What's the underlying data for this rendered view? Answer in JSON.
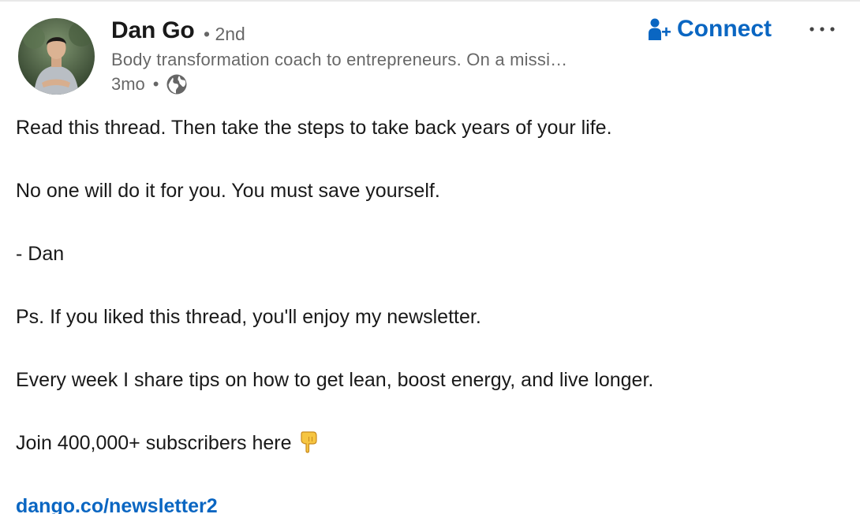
{
  "post": {
    "author": {
      "name": "Dan Go",
      "degree": "2nd",
      "headline": "Body transformation coach to entrepreneurs. On a missi…",
      "time": "3mo",
      "visibility_icon": "globe-icon"
    },
    "actions": {
      "connect_label": "Connect",
      "connect_icon": "add-person-icon",
      "more_icon": "more-options-icon"
    },
    "body": {
      "p1": "Read this thread. Then take the steps to take back years of your life.",
      "p2": "No one will do it for you. You must save yourself.",
      "p3": "- Dan",
      "p4": "Ps. If you liked this thread, you'll enjoy my newsletter.",
      "p5": "Every week I share tips on how to get lean, boost energy, and live longer.",
      "p6": "Join 400,000+ subscribers here",
      "p6_emoji_icon": "pointing-down-hand-icon",
      "link": "dango.co/newsletter2"
    }
  },
  "colors": {
    "brand_blue": "#0a66c2",
    "text_primary": "rgba(0,0,0,0.9)",
    "text_secondary": "rgba(0,0,0,0.6)"
  }
}
